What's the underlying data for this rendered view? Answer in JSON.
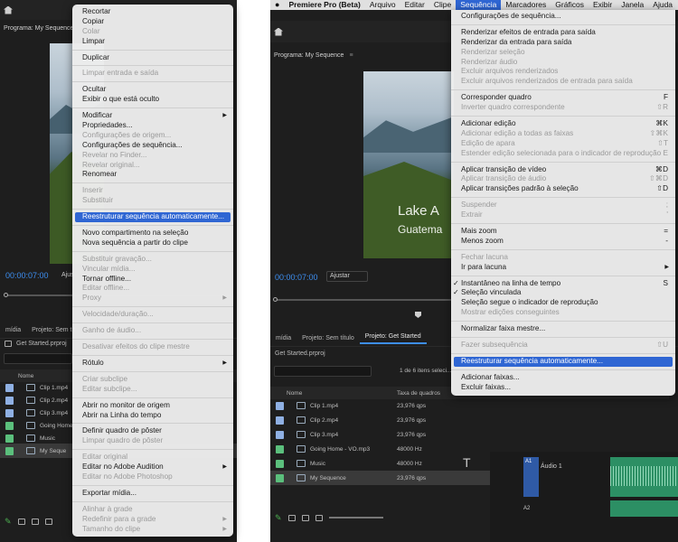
{
  "left": {
    "program_label": "Programa: My Sequence",
    "timecode": "00:00:07:00",
    "fit_label": "Ajus",
    "tabs": [
      "mídia",
      "Projeto: Sem tít"
    ],
    "project_file": "Get Started.prproj",
    "name_col": "Nome",
    "files": [
      {
        "name": "Clip 1.mp4",
        "color": "#8fb0e3"
      },
      {
        "name": "Clip 2.mp4",
        "color": "#8fb0e3"
      },
      {
        "name": "Clip 3.mp4",
        "color": "#8fb0e3"
      },
      {
        "name": "Going Home",
        "color": "#5bbf7c"
      },
      {
        "name": "Music",
        "color": "#5bbf7c"
      },
      {
        "name": "My Seque",
        "color": "#5bbf7c"
      }
    ],
    "menu": [
      {
        "label": "Recortar",
        "disabled": false
      },
      {
        "label": "Copiar",
        "disabled": false
      },
      {
        "label": "Colar",
        "disabled": true
      },
      {
        "label": "Limpar",
        "disabled": false
      },
      {
        "sep": true
      },
      {
        "label": "Duplicar",
        "disabled": false
      },
      {
        "sep": true
      },
      {
        "label": "Limpar entrada e saída",
        "disabled": true
      },
      {
        "sep": true
      },
      {
        "label": "Ocultar",
        "disabled": false
      },
      {
        "label": "Exibir o que está oculto",
        "disabled": false
      },
      {
        "sep": true
      },
      {
        "label": "Modificar",
        "disabled": false,
        "submenu": true
      },
      {
        "label": "Propriedades...",
        "disabled": false
      },
      {
        "label": "Configurações de origem...",
        "disabled": true
      },
      {
        "label": "Configurações de sequência...",
        "disabled": false
      },
      {
        "label": "Revelar no Finder...",
        "disabled": true
      },
      {
        "label": "Revelar original...",
        "disabled": true
      },
      {
        "label": "Renomear",
        "disabled": false
      },
      {
        "sep": true
      },
      {
        "label": "Inserir",
        "disabled": true
      },
      {
        "label": "Substituir",
        "disabled": true
      },
      {
        "sep": true
      },
      {
        "label": "Reestruturar sequência automaticamente...",
        "disabled": false,
        "highlight": true
      },
      {
        "sep": true
      },
      {
        "label": "Novo compartimento na seleção",
        "disabled": false
      },
      {
        "label": "Nova sequência a partir do clipe",
        "disabled": false
      },
      {
        "sep": true
      },
      {
        "label": "Substituir gravação...",
        "disabled": true
      },
      {
        "label": "Vincular mídia...",
        "disabled": true
      },
      {
        "label": "Tornar offline...",
        "disabled": false
      },
      {
        "label": "Editar offline...",
        "disabled": true
      },
      {
        "label": "Proxy",
        "disabled": true,
        "submenu": true
      },
      {
        "sep": true
      },
      {
        "label": "Velocidade/duração...",
        "disabled": true
      },
      {
        "sep": true
      },
      {
        "label": "Ganho de áudio...",
        "disabled": true
      },
      {
        "sep": true
      },
      {
        "label": "Desativar efeitos do clipe mestre",
        "disabled": true
      },
      {
        "sep": true
      },
      {
        "label": "Rótulo",
        "disabled": false,
        "submenu": true
      },
      {
        "sep": true
      },
      {
        "label": "Criar subclipe",
        "disabled": true
      },
      {
        "label": "Editar subclipe...",
        "disabled": true
      },
      {
        "sep": true
      },
      {
        "label": "Abrir no monitor de origem",
        "disabled": false
      },
      {
        "label": "Abrir na Linha do tempo",
        "disabled": false
      },
      {
        "sep": true
      },
      {
        "label": "Definir quadro de pôster",
        "disabled": false
      },
      {
        "label": "Limpar quadro de pôster",
        "disabled": true
      },
      {
        "sep": true
      },
      {
        "label": "Editar original",
        "disabled": true
      },
      {
        "label": "Editar no Adobe Audition",
        "disabled": false,
        "submenu": true
      },
      {
        "label": "Editar no Adobe Photoshop",
        "disabled": true
      },
      {
        "sep": true
      },
      {
        "label": "Exportar mídia...",
        "disabled": false
      },
      {
        "sep": true
      },
      {
        "label": "Alinhar à grade",
        "disabled": true
      },
      {
        "label": "Redefinir para a grade",
        "disabled": true,
        "submenu": true
      },
      {
        "label": "Tamanho do clipe",
        "disabled": true,
        "submenu": true
      }
    ]
  },
  "right": {
    "menubar": {
      "apple": "",
      "items": [
        "Premiere Pro (Beta)",
        "Arquivo",
        "Editar",
        "Clipe",
        "Sequência",
        "Marcadores",
        "Gráficos",
        "Exibir",
        "Janela",
        "Ajuda"
      ],
      "active": "Sequência"
    },
    "program_label": "Programa: My Sequence",
    "timecode": "00:00:07:00",
    "fit_label": "Ajustar",
    "overlay_title": "Lake A",
    "overlay_sub": "Guatema",
    "tabs": [
      "mídia",
      "Projeto: Sem título",
      "Projeto: Get Started"
    ],
    "project_file": "Get Started.prproj",
    "items_count": "1 de 6 itens seleci...",
    "name_col": "Nome",
    "rate_col": "Taxa de quadros",
    "files": [
      {
        "name": "Clip 1.mp4",
        "rate": "23,976 qps",
        "color": "#8fb0e3"
      },
      {
        "name": "Clip 2.mp4",
        "rate": "23,976 qps",
        "color": "#8fb0e3"
      },
      {
        "name": "Clip 3.mp4",
        "rate": "23,976 qps",
        "color": "#8fb0e3"
      },
      {
        "name": "Going Home - VO.mp3",
        "rate": "48000 Hz",
        "color": "#5bbf7c"
      },
      {
        "name": "Music",
        "rate": "48000 Hz",
        "color": "#5bbf7c"
      },
      {
        "name": "My Sequence",
        "rate": "23,976 qps",
        "color": "#5bbf7c"
      }
    ],
    "track_label": "Áudio 1",
    "track_tag": "A1",
    "track_tag2": "A2",
    "menu": [
      {
        "label": "Configurações de sequência...",
        "disabled": false,
        "shortcut": ""
      },
      {
        "sep": true
      },
      {
        "label": "Renderizar efeitos de entrada para saída",
        "disabled": false,
        "shortcut": ""
      },
      {
        "label": "Renderizar da entrada para saída",
        "disabled": false,
        "shortcut": ""
      },
      {
        "label": "Renderizar seleção",
        "disabled": true,
        "shortcut": ""
      },
      {
        "label": "Renderizar áudio",
        "disabled": true,
        "shortcut": ""
      },
      {
        "label": "Excluir arquivos renderizados",
        "disabled": true,
        "shortcut": ""
      },
      {
        "label": "Excluir arquivos renderizados de entrada para saída",
        "disabled": true,
        "shortcut": ""
      },
      {
        "sep": true
      },
      {
        "label": "Corresponder quadro",
        "disabled": false,
        "shortcut": "F"
      },
      {
        "label": "Inverter quadro correspondente",
        "disabled": true,
        "shortcut": "⇧R"
      },
      {
        "sep": true
      },
      {
        "label": "Adicionar edição",
        "disabled": false,
        "shortcut": "⌘K"
      },
      {
        "label": "Adicionar edição a todas as faixas",
        "disabled": true,
        "shortcut": "⇧⌘K"
      },
      {
        "label": "Edição de apara",
        "disabled": true,
        "shortcut": "⇧T"
      },
      {
        "label": "Estender edição selecionada para o indicador de reprodução",
        "disabled": true,
        "shortcut": "E"
      },
      {
        "sep": true
      },
      {
        "label": "Aplicar transição de vídeo",
        "disabled": false,
        "shortcut": "⌘D"
      },
      {
        "label": "Aplicar transição de áudio",
        "disabled": true,
        "shortcut": "⇧⌘D"
      },
      {
        "label": "Aplicar transições padrão à seleção",
        "disabled": false,
        "shortcut": "⇧D"
      },
      {
        "sep": true
      },
      {
        "label": "Suspender",
        "disabled": true,
        "shortcut": ";"
      },
      {
        "label": "Extrair",
        "disabled": true,
        "shortcut": "'"
      },
      {
        "sep": true
      },
      {
        "label": "Mais zoom",
        "disabled": false,
        "shortcut": "="
      },
      {
        "label": "Menos zoom",
        "disabled": false,
        "shortcut": "-"
      },
      {
        "sep": true
      },
      {
        "label": "Fechar lacuna",
        "disabled": true,
        "shortcut": ""
      },
      {
        "label": "Ir para lacuna",
        "disabled": false,
        "shortcut": "",
        "submenu": true
      },
      {
        "sep": true
      },
      {
        "label": "Instantâneo na linha de tempo",
        "disabled": false,
        "shortcut": "S",
        "check": true
      },
      {
        "label": "Seleção vinculada",
        "disabled": false,
        "shortcut": "",
        "check": true
      },
      {
        "label": "Seleção segue o indicador de reprodução",
        "disabled": false,
        "shortcut": ""
      },
      {
        "label": "Mostrar edições conseguintes",
        "disabled": true,
        "shortcut": ""
      },
      {
        "sep": true
      },
      {
        "label": "Normalizar faixa mestre...",
        "disabled": false,
        "shortcut": ""
      },
      {
        "sep": true
      },
      {
        "label": "Fazer subsequência",
        "disabled": true,
        "shortcut": "⇧U"
      },
      {
        "sep": true
      },
      {
        "label": "Reestruturar sequência automaticamente...",
        "disabled": false,
        "shortcut": "",
        "highlight": true
      },
      {
        "sep": true
      },
      {
        "label": "Adicionar faixas...",
        "disabled": false,
        "shortcut": ""
      },
      {
        "label": "Excluir faixas...",
        "disabled": false,
        "shortcut": ""
      }
    ]
  }
}
